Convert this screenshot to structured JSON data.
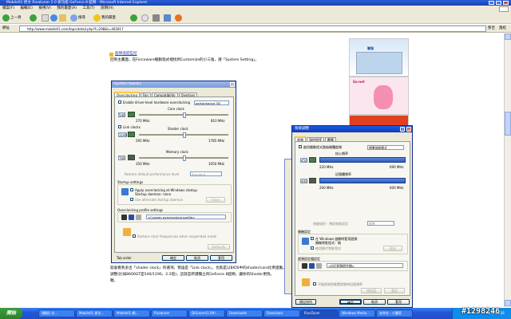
{
  "window": {
    "title": "Mobile01 原文 Rivatuner 2.0 新功能 GeForce 8 超頻 - Microsoft Internet Explorer"
  },
  "menu": [
    "檔案(F)",
    "編輯(E)",
    "檢視(V)",
    "我的最愛(A)",
    "工具(T)",
    "說明(H)"
  ],
  "toolbar": {
    "back": "上一頁",
    "search": "搜尋",
    "favorites": "我的最愛"
  },
  "address": {
    "label": "網址",
    "url": "http://www.mobile01.com/topicdetail.php?f=298&t=402817",
    "go": "移至",
    "links": "連結"
  },
  "article": {
    "heading": "超頻溫度監控",
    "intro": "回到主畫面，在Forceware驅動程式裡找到Customize的小三角，選「System Setting」。",
    "para1": "就會看到多出「shader clock」的選項，預設是「Link clock」，也就是以BIOS中的shader/core比例連動。",
    "para2": "調整(比如8600GT是540/1190，2.2倍)，這就是所謂獨立的GeForce 8超頻，讓你的Shader更快。",
    "para3": "喔。"
  },
  "ads": {
    "ad1_brand": "聯強",
    "ad2_brand": "So-net",
    "ad3_text": "今年最新行程 20 好康",
    "ad4_text": "VOLVO V50 DS R-DESIGN"
  },
  "dialog_en": {
    "title": "System tweaks",
    "tabs": [
      "Overclocking",
      "Fan",
      "Compatibility",
      "Overlays"
    ],
    "enable_hw": "Enable driver-level hardware overclocking",
    "perf_mode": "performance 3D",
    "core_clock_label": "Core clock",
    "core_value": "540",
    "core_min": "270 MHz",
    "core_max": "810 MHz",
    "link_clocks": "Link clocks",
    "shader_clock_label": "Shader clock",
    "shader_value": "1190",
    "shader_min": "595 MHz",
    "shader_max": "1785 MHz",
    "memory_clock_label": "Memory clock",
    "memory_value": "700",
    "memory_min": "350 MHz",
    "memory_max": "1050 MHz",
    "perf_level": "Restore default performance level",
    "perf_level_value": "Standard",
    "startup_settings": "Startup settings",
    "apply_startup": "Apply overclocking at Windows startup",
    "startup_daemon": "Startup daemon: none",
    "alt_startup": "Use alternate startup daemon",
    "save": "Save",
    "profile_settings": "Overclocking profile settings",
    "profile_value": "<Custom overclocking profile>",
    "restore_desktop": "Restore clock frequencies when suspended mode",
    "defaults": "Defaults",
    "tab_order": "Tab order",
    "ok": "確定",
    "cancel": "取消",
    "apply": "套用"
  },
  "dialog_zh": {
    "title": "系統調整",
    "tabs": [
      "超頻",
      "溫控程序",
      "覆蓋"
    ],
    "enable_hw": "啟用驅動程式層級硬體超頻",
    "perf_mode": "標準效能模式",
    "core_label": "核心頻率",
    "core_value": "450",
    "core_min": "220 MHz",
    "core_max": "690 MHz",
    "mem_label": "記憶體頻率",
    "mem_value": "400",
    "mem_min": "200 MHz",
    "mem_max": "600 MHz",
    "perf_level": "效能級別：預設效能設定",
    "perf_level_value": "標準",
    "startup_settings": "開機設定",
    "apply_startup": "在 Windows 啟動時套用超頻",
    "startup_daemon": "開機常駐程式：無",
    "alt_startup": "使用替代常駐程式",
    "save": "保存",
    "profile_settings": "超頻設定檔設定",
    "profile_value": "<自訂超頻設定檔>",
    "restore_label": "不能偵測到裝置狀態時回復頻率",
    "defaults": "預設值",
    "reset": "重設",
    "ok": "確定",
    "cancel": "取消",
    "apply": "套用",
    "tab_order": "標記排列"
  },
  "taskbar": {
    "start": "開始",
    "items": [
      "[轉錄] 光...",
      "Mobile01 原文...",
      "Mobile01 網...",
      "Rivatuner",
      "DiGroom(1.09) ...",
      "Downloads",
      "Download",
      "RivaTuner",
      "Windows Media...",
      "未命名 - 小畫家"
    ],
    "clock": "下午 04:26"
  },
  "watermark": "#1298246",
  "colors": {
    "xp_blue": "#1c58e0",
    "dialog_bg": "#ece9d8",
    "bar_blue": "#2a5bc2"
  }
}
